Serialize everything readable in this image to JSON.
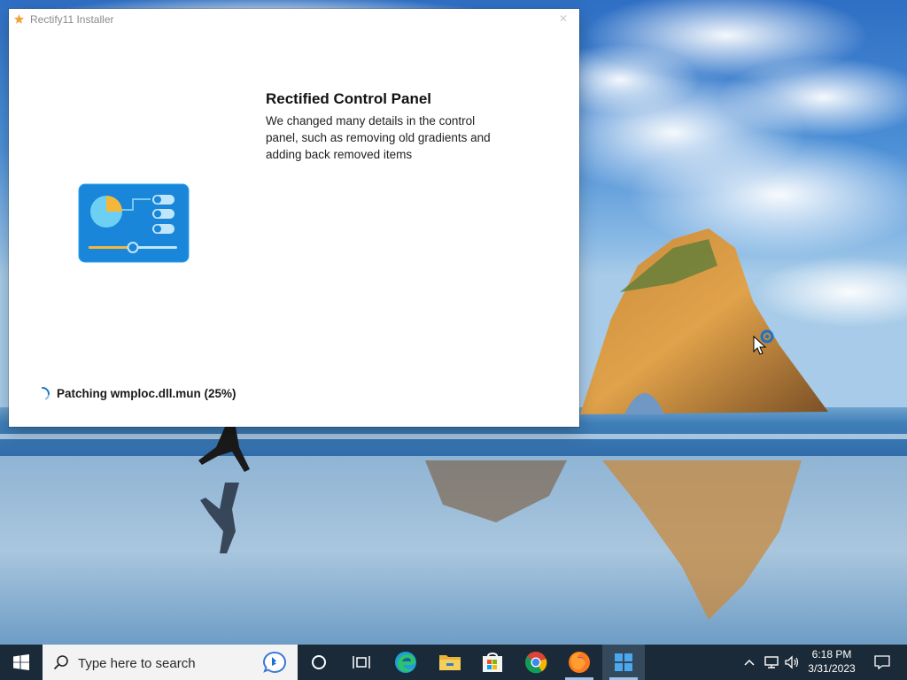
{
  "window": {
    "title": "Rectify11 Installer",
    "close_symbol": "✕"
  },
  "feature": {
    "icon": "control-panel-icon",
    "title": "Rectified Control Panel",
    "description": "We changed many details in the control panel, such as removing old gradients and adding back removed items"
  },
  "status": {
    "text": "Patching wmploc.dll.mun (25%)",
    "progress_percent": 25
  },
  "taskbar": {
    "search_placeholder": "Type here to search",
    "apps": [
      "task-view",
      "edge",
      "file-explorer",
      "microsoft-store",
      "chrome",
      "firefox",
      "rectify11-installer"
    ],
    "time": "6:18 PM",
    "date": "3/31/2023"
  },
  "colors": {
    "taskbar": "#1b2a38",
    "accent_blue": "#1a86d9",
    "spinner": "#1a73c9"
  }
}
